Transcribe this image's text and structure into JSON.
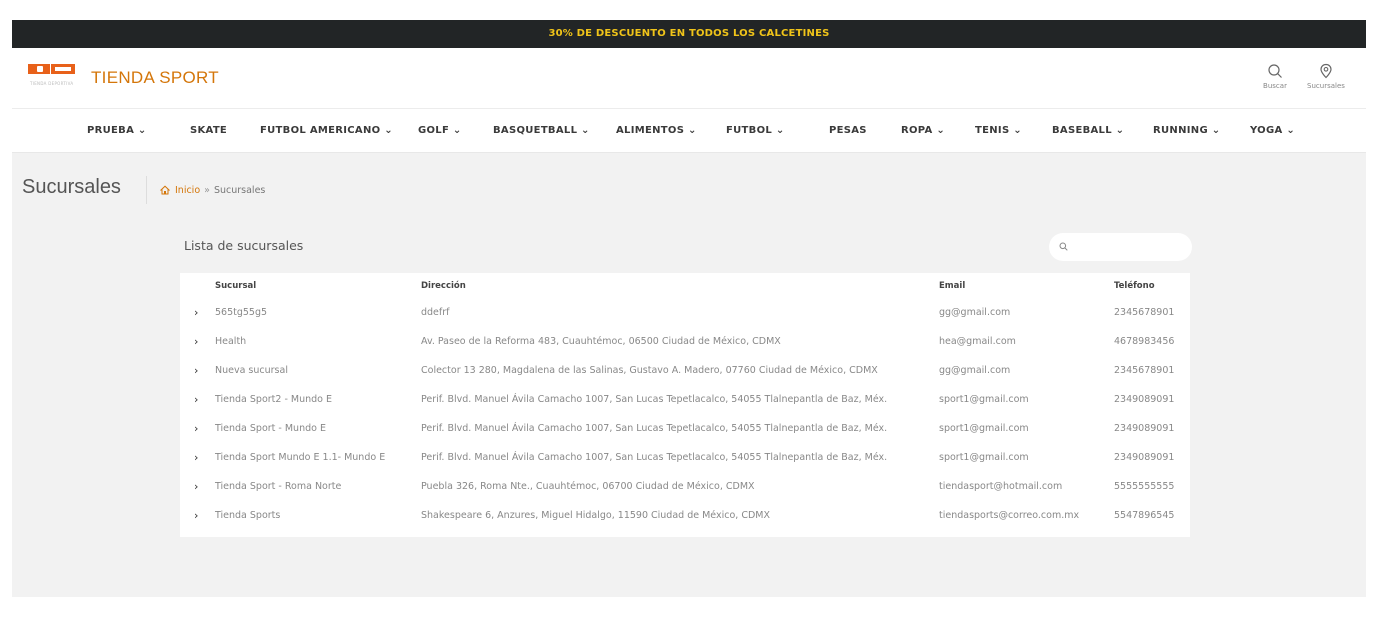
{
  "promo": {
    "text": "30% DE DESCUENTO EN TODOS LOS CALCETINES"
  },
  "header": {
    "brand": "TIENDA SPORT",
    "logo_tagline": "TIENDA DEPORTIVA",
    "actions": {
      "search_label": "Buscar",
      "branches_label": "Sucursales"
    }
  },
  "nav": {
    "items": [
      {
        "label": "PRUEBA ⌄",
        "icon": "chevron-down-icon"
      },
      {
        "label": "SKATE"
      },
      {
        "label": "FUTBOL AMERICANO ⌄"
      },
      {
        "label": "GOLF ⌄"
      },
      {
        "label": "BASQUETBALL ⌄"
      },
      {
        "label": "ALIMENTOS ⌄"
      },
      {
        "label": "FUTBOL ⌄"
      },
      {
        "label": "PESAS"
      },
      {
        "label": "ROPA ⌄"
      },
      {
        "label": "TENIS ⌄"
      },
      {
        "label": "BASEBALL ⌄"
      },
      {
        "label": "RUNNING ⌄"
      },
      {
        "label": "YOGA ⌄"
      }
    ]
  },
  "breadcrumb": {
    "page_title": "Sucursales",
    "home": "Inicio",
    "separator": "»",
    "current": "Sucursales",
    "home_icon": "home-icon"
  },
  "list": {
    "title": "Lista de sucursales",
    "search_placeholder": ""
  },
  "table": {
    "headers": {
      "name": "Sucursal",
      "address": "Dirección",
      "email": "Email",
      "phone": "Teléfono"
    },
    "rows": [
      {
        "name": "565tg55g5",
        "address": "ddefrf",
        "email": "gg@gmail.com",
        "phone": "2345678901"
      },
      {
        "name": "Health",
        "address": "Av. Paseo de la Reforma 483, Cuauhtémoc, 06500 Ciudad de México, CDMX",
        "email": "hea@gmail.com",
        "phone": "4678983456"
      },
      {
        "name": "Nueva sucursal",
        "address": "Colector 13 280, Magdalena de las Salinas, Gustavo A. Madero, 07760 Ciudad de México, CDMX",
        "email": "gg@gmail.com",
        "phone": "2345678901"
      },
      {
        "name": "Tienda Sport2 - Mundo E",
        "address": "Perif. Blvd. Manuel Ávila Camacho 1007, San Lucas Tepetlacalco, 54055 Tlalnepantla de Baz, Méx.",
        "email": "sport1@gmail.com",
        "phone": "2349089091"
      },
      {
        "name": "Tienda Sport - Mundo E",
        "address": "Perif. Blvd. Manuel Ávila Camacho 1007, San Lucas Tepetlacalco, 54055 Tlalnepantla de Baz, Méx.",
        "email": "sport1@gmail.com",
        "phone": "2349089091"
      },
      {
        "name": "Tienda Sport Mundo E 1.1- Mundo E",
        "address": "Perif. Blvd. Manuel Ávila Camacho 1007, San Lucas Tepetlacalco, 54055 Tlalnepantla de Baz, Méx.",
        "email": "sport1@gmail.com",
        "phone": "2349089091"
      },
      {
        "name": "Tienda Sport - Roma Norte",
        "address": "Puebla 326, Roma Nte., Cuauhtémoc, 06700 Ciudad de México, CDMX",
        "email": "tiendasport@hotmail.com",
        "phone": "5555555555"
      },
      {
        "name": "Tienda Sports",
        "address": "Shakespeare 6, Anzures, Miguel Hidalgo, 11590 Ciudad de México, CDMX",
        "email": "tiendasports@correo.com.mx",
        "phone": "5547896545"
      }
    ],
    "row_expand_icon": "chevron-right-icon"
  },
  "colors": {
    "brand": "#d4760a",
    "promo_bg": "#222526",
    "promo_text": "#f0c419",
    "logo": "#e8611a"
  }
}
